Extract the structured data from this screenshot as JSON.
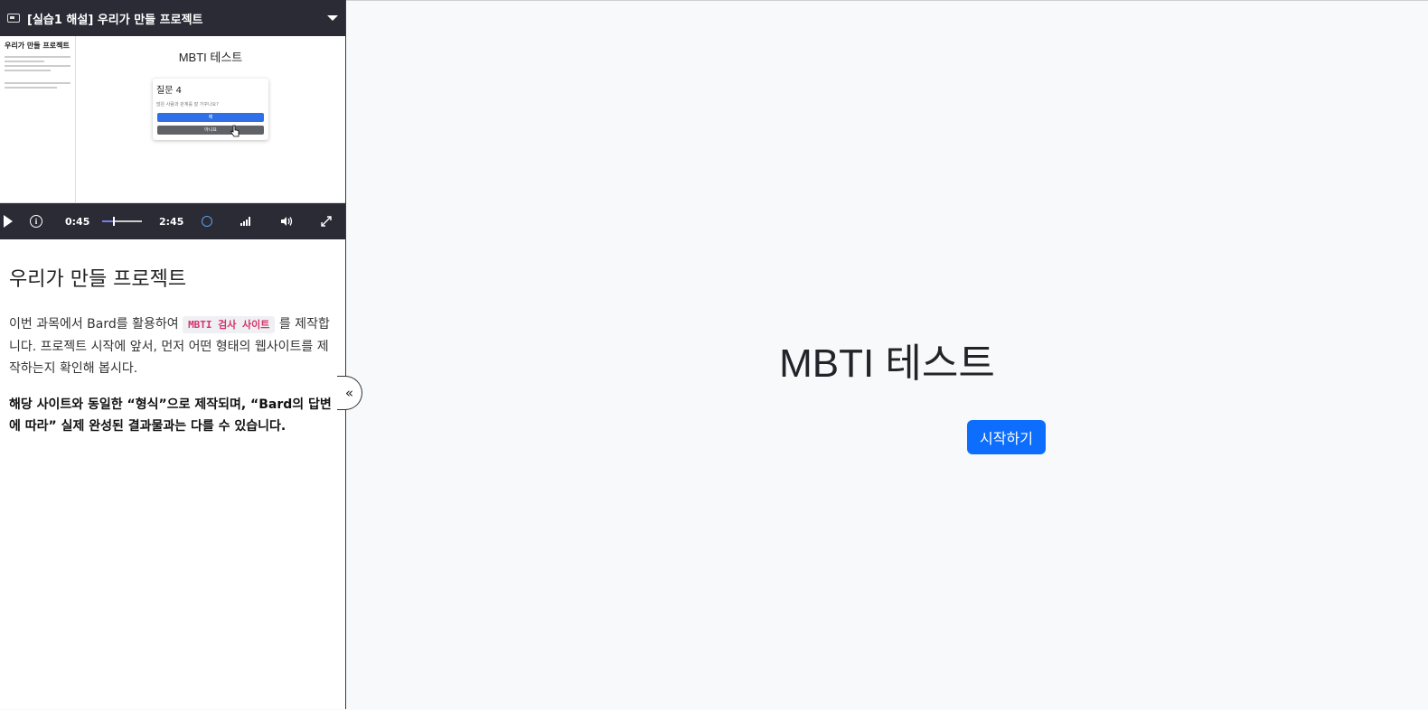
{
  "video": {
    "header_title": "[실습1 해설] 우리가 만들 프로젝트",
    "thumb": {
      "sidebar_title": "우리가 만들 프로젝트",
      "app_title": "MBTI 테스트",
      "question_title": "질문 4",
      "question_text": "많은 사람과 관계를 잘 가꾸나요?",
      "yes_label": "예",
      "no_label": "아니요"
    },
    "current_time": "0:45",
    "duration": "2:45",
    "progress": 0.27
  },
  "lesson": {
    "title": "우리가 만들 프로젝트",
    "para1_before": "이번 과목에서 Bard를 활용하여 ",
    "para1_code": "MBTI 검사 사이트",
    "para1_after": " 를 제작합니다. 프로젝트 시작에 앞서, 먼저 어떤 형태의 웹사이트를 제작하는지 확인해 봅시다.",
    "para2": "해당 사이트와 동일한 “형식”으로 제작되며, “Bard의 답변에 따라” 실제 완성된 결과물과는 다를 수 있습니다."
  },
  "collapse_label": "«",
  "app": {
    "title": "MBTI 테스트",
    "start_button": "시작하기"
  },
  "colors": {
    "primary": "#0d6efd",
    "player_bg": "#2b2b36",
    "code_text": "#d6336c"
  }
}
